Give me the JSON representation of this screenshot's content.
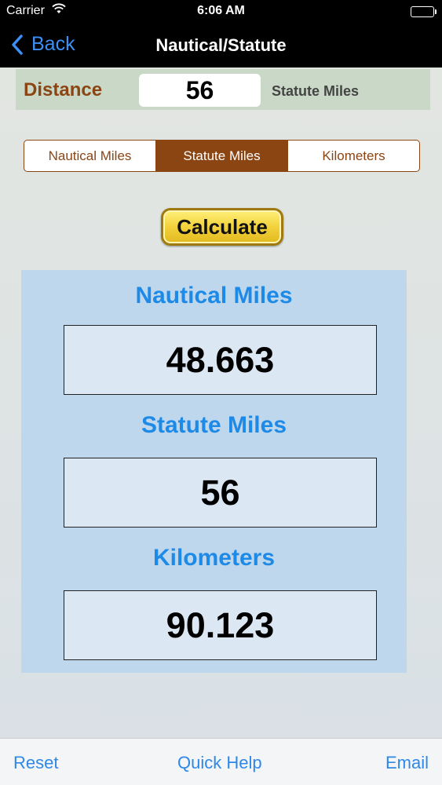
{
  "status_bar": {
    "carrier": "Carrier",
    "time": "6:06 AM"
  },
  "nav": {
    "back_label": "Back",
    "title": "Nautical/Statute"
  },
  "distance": {
    "label": "Distance",
    "value": "56",
    "unit": "Statute Miles"
  },
  "segments": {
    "items": [
      "Nautical Miles",
      "Statute Miles",
      "Kilometers"
    ],
    "selected": "Statute Miles"
  },
  "calculate_label": "Calculate",
  "results": {
    "nautical_label": "Nautical Miles",
    "nautical_value": "48.663",
    "statute_label": "Statute Miles",
    "statute_value": "56",
    "km_label": "Kilometers",
    "km_value": "90.123"
  },
  "toolbar": {
    "reset": "Reset",
    "quick_help": "Quick Help",
    "email": "Email"
  },
  "colors": {
    "accent_brown": "#8b4513",
    "ios_blue": "#2f88e8",
    "result_blue": "#1e8ae8"
  }
}
